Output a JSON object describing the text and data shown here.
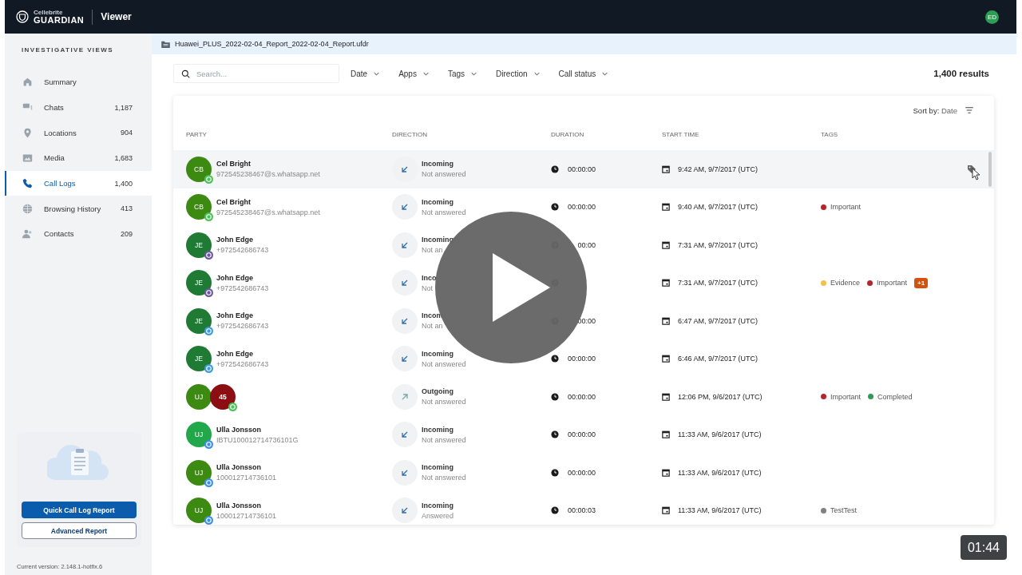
{
  "header": {
    "brand_small": "Cellebrite",
    "brand": "GUARDIAN",
    "title": "Viewer",
    "user_initials": "ED"
  },
  "sidebar": {
    "heading": "INVESTIGATIVE VIEWS",
    "items": [
      {
        "kind": "home",
        "label": "Summary",
        "selected": false
      },
      {
        "kind": "chat",
        "label": "Chats",
        "count": "1,187",
        "selected": false
      },
      {
        "kind": "pin",
        "label": "Locations",
        "count": "904",
        "selected": false
      },
      {
        "kind": "media",
        "label": "Media",
        "count": "1,683",
        "selected": false
      },
      {
        "kind": "phone",
        "label": "Call Logs",
        "count": "1,400",
        "selected": true
      },
      {
        "kind": "globe",
        "label": "Browsing History",
        "count": "413",
        "selected": false
      },
      {
        "kind": "people",
        "label": "Contacts",
        "count": "209",
        "selected": false
      }
    ],
    "report_buttons": [
      {
        "label": "Quick Call Log Report",
        "kind": "primary"
      },
      {
        "label": "Advanced Report",
        "kind": "outline"
      }
    ],
    "version": "Current version: 2.148.1-hotfix.6"
  },
  "breadcrumb": "Huawei_PLUS_2022-02-04_Report_2022-02-04_Report.ufdr",
  "search": {
    "placeholder": "Search..."
  },
  "filters": [
    "Date",
    "Apps",
    "Tags",
    "Direction",
    "Call status"
  ],
  "results": "1,400 results",
  "sort": {
    "label": "Sort by:",
    "value": "Date"
  },
  "table": {
    "columns": [
      "PARTY",
      "DIRECTION",
      "DURATION",
      "START TIME",
      "TAGS"
    ],
    "rows": [
      {
        "selected": true,
        "avatars": [
          {
            "initials": "CB",
            "color": "#3d8a12"
          }
        ],
        "app_badge": {
          "color": "#4cc15a"
        },
        "name": "Cel Bright",
        "handle": "972545238467@s.whatsapp.net",
        "direction": {
          "kind": "incoming",
          "label": "Incoming",
          "status": "Not answered"
        },
        "duration": "00:00:00",
        "start": "9:42 AM, 9/7/2017 (UTC)",
        "tags": []
      },
      {
        "selected": false,
        "avatars": [
          {
            "initials": "CB",
            "color": "#3d8a12"
          }
        ],
        "app_badge": {
          "color": "#4cc15a"
        },
        "name": "Cel Bright",
        "handle": "972545238467@s.whatsapp.net",
        "direction": {
          "kind": "incoming",
          "label": "Incoming",
          "status": "Not answered"
        },
        "duration": "00:00:00",
        "start": "9:40 AM, 9/7/2017 (UTC)",
        "tags": [
          {
            "label": "Important",
            "color": "#b3262e"
          }
        ]
      },
      {
        "selected": false,
        "avatars": [
          {
            "initials": "JE",
            "color": "#1f7a34"
          }
        ],
        "app_badge": {
          "color": "#6a5a9c"
        },
        "name": "John Edge",
        "handle": "+972542686743",
        "direction": {
          "kind": "incoming",
          "label": "Incoming",
          "status": "Not an"
        },
        "duration": "00:00",
        "start": "7:31 AM, 9/7/2017 (UTC)",
        "tags": []
      },
      {
        "selected": false,
        "avatars": [
          {
            "initials": "JE",
            "color": "#1f7a34"
          }
        ],
        "app_badge": {
          "color": "#6a5a9c"
        },
        "name": "John Edge",
        "handle": "+972542686743",
        "direction": {
          "kind": "incoming",
          "label": "Inco",
          "status": "Not"
        },
        "start": "7:31 AM, 9/7/2017 (UTC)",
        "tags": [
          {
            "label": "Evidence",
            "color": "#f0c24a"
          },
          {
            "label": "Important",
            "color": "#b3262e"
          }
        ],
        "more": "+1"
      },
      {
        "selected": false,
        "avatars": [
          {
            "initials": "JE",
            "color": "#1f7a34"
          }
        ],
        "app_badge": {
          "color": "#3f9ad6"
        },
        "name": "John Edge",
        "handle": "+972542686743",
        "direction": {
          "kind": "incoming",
          "label": "Incom",
          "status": "Not an"
        },
        "duration": "00:00",
        "start": "6:47 AM, 9/7/2017 (UTC)",
        "tags": []
      },
      {
        "selected": false,
        "avatars": [
          {
            "initials": "JE",
            "color": "#1f7a34"
          }
        ],
        "app_badge": {
          "color": "#3f9ad6"
        },
        "name": "John Edge",
        "handle": "+972542686743",
        "direction": {
          "kind": "incoming",
          "label": "Incoming",
          "status": "Not answered"
        },
        "duration": "00:00:00",
        "start": "6:46 AM, 9/7/2017 (UTC)",
        "tags": []
      },
      {
        "selected": false,
        "avatars": [
          {
            "initials": "UJ",
            "color": "#3d8a12"
          },
          {
            "initials": "45",
            "color": "#8c0d12"
          }
        ],
        "app_badge": {
          "color": "#4cc15a"
        },
        "direction": {
          "kind": "outgoing",
          "label": "Outgoing",
          "status": "Not answered"
        },
        "duration": "00:00:00",
        "start": "12:06 PM, 9/6/2017 (UTC)",
        "tags": [
          {
            "label": "Important",
            "color": "#b3262e"
          },
          {
            "label": "Completed",
            "color": "#2e9c54"
          }
        ]
      },
      {
        "selected": false,
        "avatars": [
          {
            "initials": "UJ",
            "color": "#22a84a"
          }
        ],
        "app_badge": {
          "color": "#3f8fe0"
        },
        "name": "Ulla Jonsson",
        "handle": "IBTU100012714736101G",
        "direction": {
          "kind": "incoming",
          "label": "Incoming",
          "status": "Not answered"
        },
        "duration": "00:00:00",
        "start": "11:33 AM, 9/6/2017 (UTC)",
        "tags": []
      },
      {
        "selected": false,
        "avatars": [
          {
            "initials": "UJ",
            "color": "#3d8a12"
          }
        ],
        "app_badge": {
          "color": "#3f8fe0"
        },
        "name": "Ulla Jonsson",
        "handle": "100012714736101",
        "direction": {
          "kind": "incoming",
          "label": "Incoming",
          "status": "Not answered"
        },
        "duration": "00:00:00",
        "start": "11:33 AM, 9/6/2017 (UTC)",
        "tags": []
      },
      {
        "selected": false,
        "avatars": [
          {
            "initials": "UJ",
            "color": "#3d8a12"
          }
        ],
        "app_badge": {
          "color": "#3f8fe0"
        },
        "name": "Ulla Jonsson",
        "handle": "100012714736101",
        "direction": {
          "kind": "incoming",
          "label": "Incoming",
          "status": "Answered"
        },
        "duration": "00:00:03",
        "start": "11:33 AM, 9/6/2017 (UTC)",
        "tags": [
          {
            "label": "TestTest",
            "color": "#808080"
          }
        ]
      }
    ]
  },
  "video": {
    "time": "01:44"
  }
}
